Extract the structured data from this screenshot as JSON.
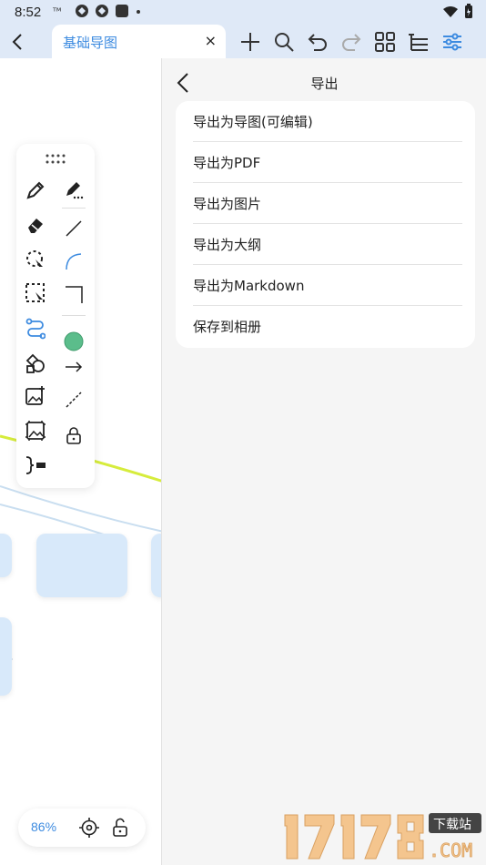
{
  "status_bar": {
    "time": "8:52",
    "carrier_icon": "network-type-icon"
  },
  "toolbar": {
    "tab_title": "基础导图",
    "tab_close": "×",
    "icons": [
      "back-icon",
      "add-icon",
      "search-icon",
      "undo-icon",
      "redo-icon",
      "grid-layout-icon",
      "outline-icon",
      "settings-sliders-icon"
    ]
  },
  "palette": {
    "tools": [
      "pen-icon",
      "marker-pen-icon",
      "eraser-icon",
      "line-icon",
      "lasso-icon",
      "arc-icon",
      "rect-select-icon",
      "corner-line-icon",
      "connector-icon",
      "color-swatch",
      "shape-icon",
      "arrow-icon",
      "add-image-icon",
      "dashed-line-icon",
      "image-icon",
      "lock-icon",
      "summary-bracket-icon"
    ],
    "swatch_color": "#5bbd8b"
  },
  "zoom": {
    "level": "86%"
  },
  "export_panel": {
    "title": "导出",
    "items": [
      {
        "label": "导出为导图(可编辑)"
      },
      {
        "label": "导出为PDF"
      },
      {
        "label": "导出为图片"
      },
      {
        "label": "导出为大纲"
      },
      {
        "label": "导出为Markdown"
      },
      {
        "label": "保存到相册"
      }
    ]
  },
  "colors": {
    "accent": "#3d8be0",
    "toolbar_bg": "#dfe9f7",
    "node_fill": "#d8e9fa",
    "highlight_line": "#d6ec3c"
  }
}
